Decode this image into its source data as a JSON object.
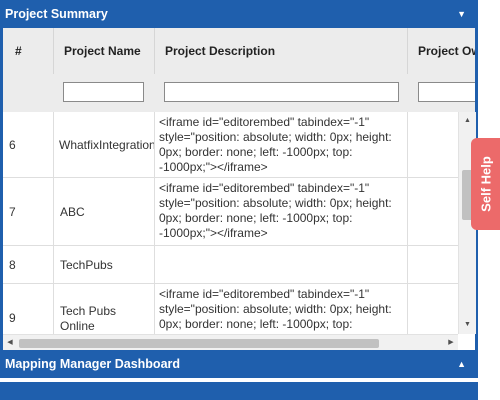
{
  "panels": {
    "project_summary": {
      "title": "Project Summary"
    },
    "mapping_manager": {
      "title": "Mapping Manager Dashboard"
    }
  },
  "table": {
    "headers": [
      "#",
      "Project Name",
      "Project Description",
      "Project Ow"
    ],
    "rows": [
      {
        "num": "6",
        "name": "WhatfixIntegration",
        "desc": "<iframe id=\"editorembed\" tabindex=\"-1\" style=\"position: absolute; width: 0px; height: 0px; border: none; left: -1000px; top: -1000px;\"></iframe>"
      },
      {
        "num": "7",
        "name": "ABC",
        "desc": "<iframe id=\"editorembed\" tabindex=\"-1\" style=\"position: absolute; width: 0px; height: 0px; border: none; left: -1000px; top: -1000px;\"></iframe>"
      },
      {
        "num": "8",
        "name": "TechPubs",
        "desc": ""
      },
      {
        "num": "9",
        "name": "Tech Pubs Online",
        "desc": "<iframe id=\"editorembed\" tabindex=\"-1\" style=\"position: absolute; width: 0px; height: 0px; border: none; left: -1000px; top:"
      }
    ]
  },
  "self_help": {
    "label": "Self Help"
  },
  "icons": {
    "panel_toggle_down": "chevron-down-icon",
    "panel_toggle_up": "chevron-up-icon"
  }
}
